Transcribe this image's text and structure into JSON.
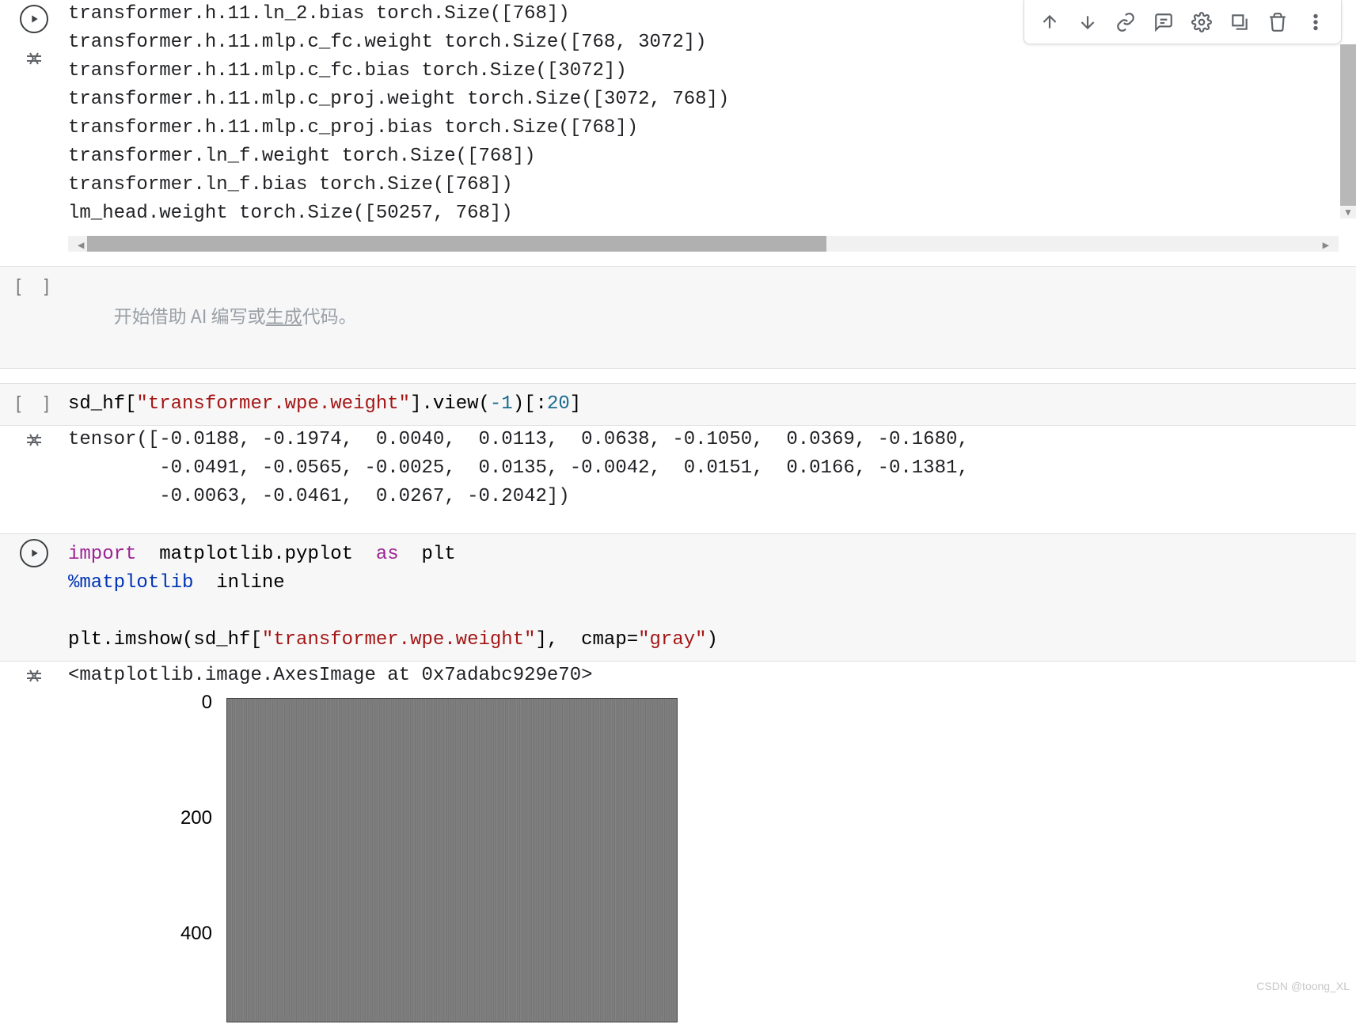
{
  "toolbar": {
    "move_up": "Move cell up",
    "move_down": "Move cell down",
    "link": "Link to cell",
    "comment": "Add comment",
    "settings": "Open settings",
    "mirror": "Mirror cell in tab",
    "delete": "Delete cell",
    "more": "More cell actions"
  },
  "cell0": {
    "output_lines": [
      "transformer.h.11.ln_2.bias torch.Size([768])",
      "transformer.h.11.mlp.c_fc.weight torch.Size([768, 3072])",
      "transformer.h.11.mlp.c_fc.bias torch.Size([3072])",
      "transformer.h.11.mlp.c_proj.weight torch.Size([3072, 768])",
      "transformer.h.11.mlp.c_proj.bias torch.Size([768])",
      "transformer.ln_f.weight torch.Size([768])",
      "transformer.ln_f.bias torch.Size([768])",
      "lm_head.weight torch.Size([50257, 768])"
    ]
  },
  "cell1": {
    "placeholder_prefix": "开始借助 AI 编写或",
    "placeholder_underlined": "生成",
    "placeholder_suffix": "代码。"
  },
  "cell2": {
    "code_prefix": "sd_hf[",
    "code_str": "\"transformer.wpe.weight\"",
    "code_mid1": "].view(",
    "code_neg1": "-1",
    "code_mid2": ")[:",
    "code_twenty": "20",
    "code_end": "]",
    "output_lines": [
      "tensor([-0.0188, -0.1974,  0.0040,  0.0113,  0.0638, -0.1050,  0.0369, -0.1680,",
      "        -0.0491, -0.0565, -0.0025,  0.0135, -0.0042,  0.0151,  0.0166, -0.1381,",
      "        -0.0063, -0.0461,  0.0267, -0.2042])"
    ]
  },
  "cell3": {
    "kw_import": "import",
    "mod": "  matplotlib.pyplot  ",
    "kw_as": "as",
    "alias": "  plt",
    "magic": "%matplotlib",
    "magic_arg": "  inline",
    "line3_a": "plt.imshow(sd_hf[",
    "line3_str": "\"transformer.wpe.weight\"",
    "line3_b": "],  cmap=",
    "line3_cmap": "\"gray\"",
    "line3_c": ")",
    "output_repr": "<matplotlib.image.AxesImage at 0x7adabc929e70>"
  },
  "chart_data": {
    "type": "heatmap",
    "title": "",
    "xlabel": "",
    "ylabel": "",
    "y_ticks_visible": [
      0,
      200,
      400
    ],
    "ylim_visible": [
      0,
      400
    ],
    "cmap": "gray",
    "data_source": "sd_hf[\"transformer.wpe.weight\"]",
    "note": "Image is a grayscale imshow of the positional embedding weight matrix; only the top portion (rows ~0–400) is visible in the viewport."
  },
  "watermark": "CSDN @toong_XL"
}
